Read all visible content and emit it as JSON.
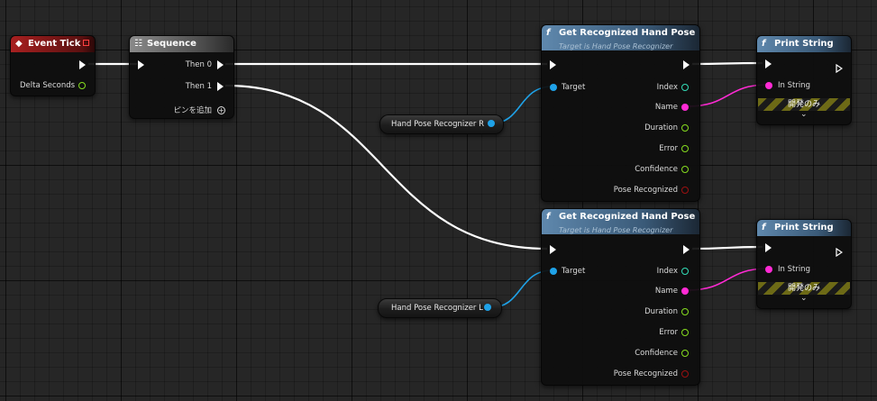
{
  "colors": {
    "exec": "#ffffff",
    "object": "#1fa2e8",
    "string": "#ff2ad4",
    "int": "#33ddb8",
    "float": "#86dc1f",
    "bool": "#8a1010"
  },
  "icons": {
    "event": "event-diamond-icon",
    "sequence": "sequence-icon",
    "function": "function-f-icon",
    "add_pin": "add-pin-plus-icon",
    "expand": "chevron-down-icon"
  },
  "event_tick": {
    "title": "Event Tick",
    "delta_seconds": "Delta Seconds"
  },
  "sequence": {
    "title": "Sequence",
    "then0": "Then 0",
    "then1": "Then 1",
    "add_pin": "ピンを追加"
  },
  "var_r": {
    "label": "Hand Pose Recognizer R"
  },
  "var_l": {
    "label": "Hand Pose Recognizer L"
  },
  "get_pose": [
    {
      "title": "Get Recognized Hand Pose",
      "subtitle": "Target is Hand Pose Recognizer",
      "target": "Target",
      "index": "Index",
      "name": "Name",
      "duration": "Duration",
      "error": "Error",
      "confidence": "Confidence",
      "pose_recognized": "Pose Recognized"
    },
    {
      "title": "Get Recognized Hand Pose",
      "subtitle": "Target is Hand Pose Recognizer",
      "target": "Target",
      "index": "Index",
      "name": "Name",
      "duration": "Duration",
      "error": "Error",
      "confidence": "Confidence",
      "pose_recognized": "Pose Recognized"
    }
  ],
  "print_string": [
    {
      "title": "Print String",
      "in_string": "In String",
      "dev_only": "開発のみ"
    },
    {
      "title": "Print String",
      "in_string": "In String",
      "dev_only": "開発のみ"
    }
  ]
}
